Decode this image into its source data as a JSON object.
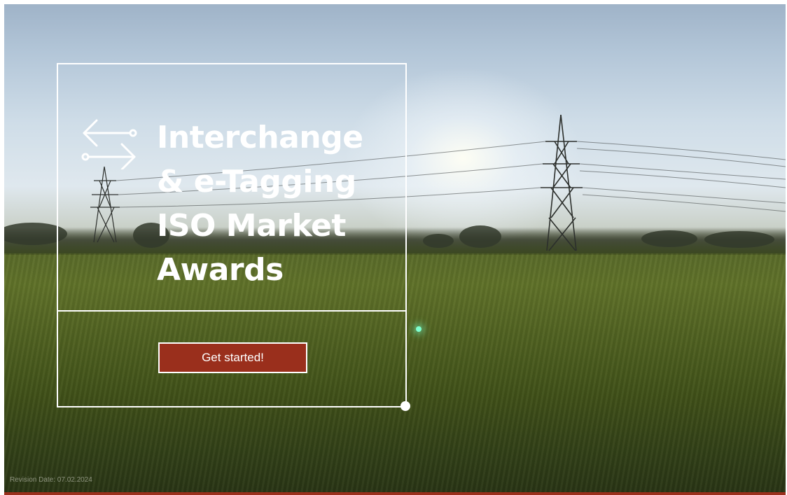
{
  "hero": {
    "title_lines": [
      "Interchange",
      "& e-Tagging",
      "ISO Market",
      "Awards"
    ],
    "cta_label": "Get started!",
    "revision": "Revision Date: 07.02.2024",
    "icon": "exchange-arrows-icon"
  },
  "colors": {
    "accent": "#9a2f1c",
    "frame": "#ffffff",
    "text": "#ffffff"
  }
}
